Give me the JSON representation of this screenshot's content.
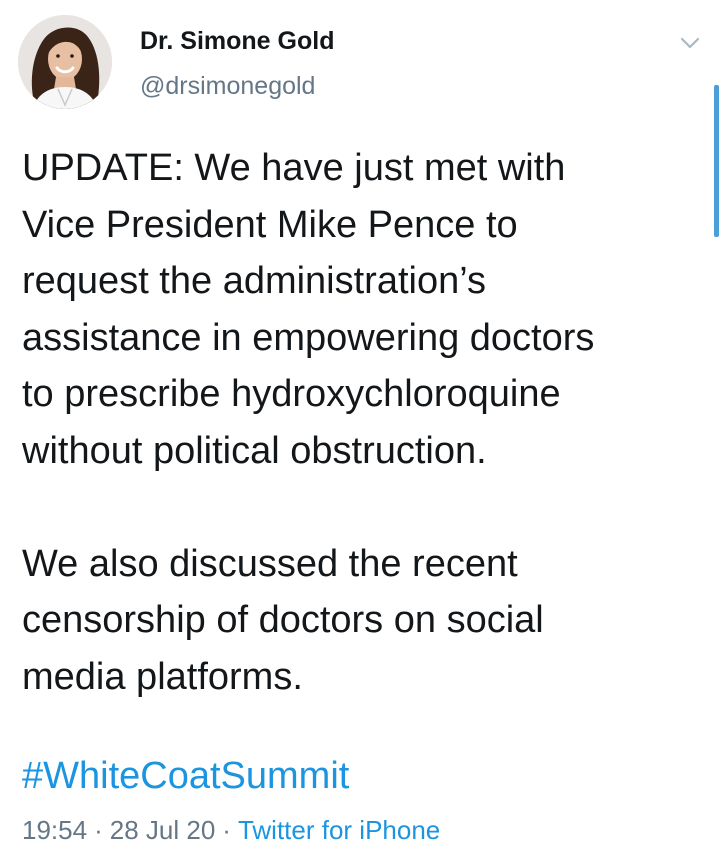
{
  "tweet": {
    "author": {
      "display_name": "Dr. Simone Gold",
      "handle": "@drsimonegold"
    },
    "body": {
      "paragraph_1": "UPDATE: We have just met with\nVice President Mike Pence to\nrequest the administration’s\nassistance in empowering doctors\nto prescribe hydroxychloroquine\nwithout political obstruction.",
      "paragraph_2": "We also discussed the recent\ncensorship of doctors on social\nmedia platforms."
    },
    "hashtag": "#WhiteCoatSummit",
    "meta": {
      "time": "19:54",
      "separator": "·",
      "date": "28 Jul 20",
      "source": "Twitter for iPhone"
    },
    "colors": {
      "text": "#14171a",
      "secondary": "#657786",
      "link": "#1b95e0"
    },
    "icons": {
      "menu": "chevron-down-icon"
    }
  }
}
